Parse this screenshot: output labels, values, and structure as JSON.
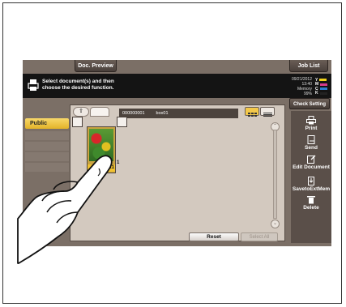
{
  "top_tabs": {
    "preview": "Doc. Preview",
    "job_list": "Job List"
  },
  "message": {
    "line1": "Select document(s) and then",
    "line2": "choose the desired function."
  },
  "status": {
    "datetime": "09/21/2012",
    "time": "13:40",
    "memory_label": "Memory",
    "memory_value": "99%"
  },
  "toner": [
    {
      "letter": "Y",
      "color": "#f2d21b"
    },
    {
      "letter": "M",
      "color": "#d63b8a"
    },
    {
      "letter": "C",
      "color": "#2f7dd1"
    },
    {
      "letter": "K",
      "color": "#222222"
    }
  ],
  "check_setting": "Check Setting",
  "sidebar": {
    "selected": "Public"
  },
  "path": {
    "box_number": "000000001",
    "box_name": "box01"
  },
  "document": {
    "name": "ent1",
    "count": "1"
  },
  "buttons": {
    "reset": "Reset",
    "select_all": "Select All"
  },
  "functions": [
    {
      "label": "Print",
      "icon": "print-icon"
    },
    {
      "label": "Send",
      "icon": "send-icon"
    },
    {
      "label": "Edit Document",
      "icon": "edit-document-icon"
    },
    {
      "label": "SavetoExtMem",
      "icon": "save-ext-memory-icon"
    },
    {
      "label": "Delete",
      "icon": "delete-icon"
    }
  ],
  "accent_color": "#f3c84a"
}
